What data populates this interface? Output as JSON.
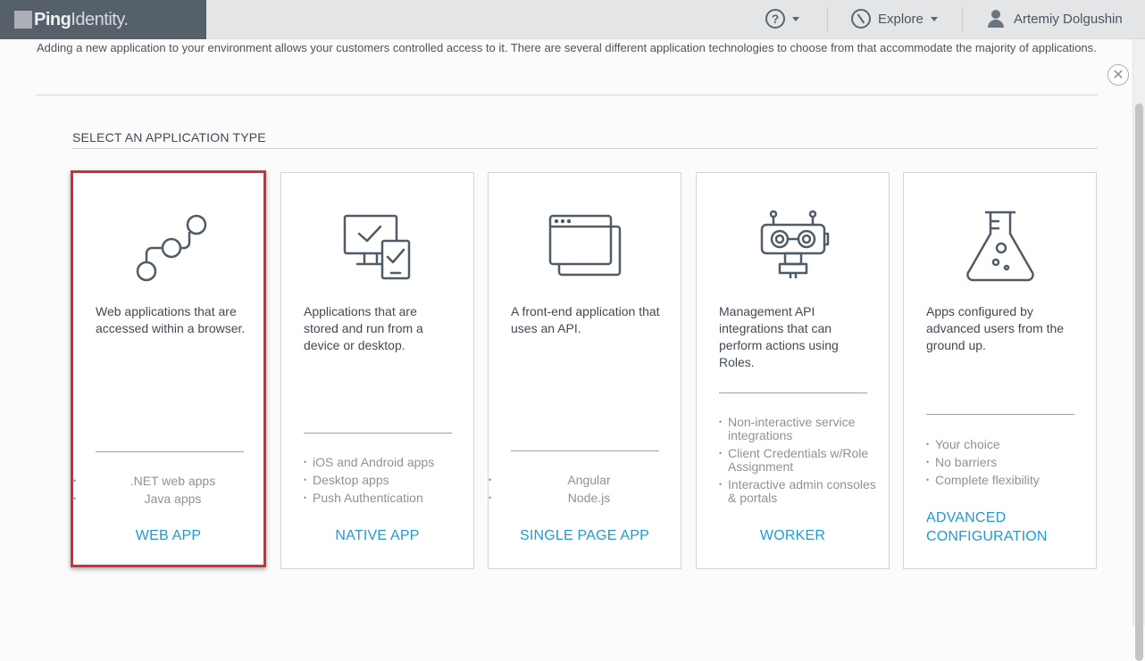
{
  "header": {
    "brand_bold": "Ping",
    "brand_light": "Identity.",
    "explore_label": "Explore",
    "user_name": "Artemiy Dolgushin"
  },
  "intro": {
    "text": "Adding a new application to your environment allows your customers controlled access to it. There are several different application technologies to choose from that accommodate the majority of applications."
  },
  "close_symbol": "✕",
  "section_title": "SELECT AN APPLICATION TYPE",
  "cards": [
    {
      "description": "Web applications that are accessed within a browser.",
      "items": [
        ".NET web apps",
        "Java apps"
      ],
      "link": "WEB APP",
      "icon": "workflow-nodes-icon"
    },
    {
      "description": "Applications that are stored and run from a device or desktop.",
      "items": [
        "iOS and Android apps",
        "Desktop apps",
        "Push Authentication"
      ],
      "link": "NATIVE APP",
      "icon": "monitor-device-check-icon"
    },
    {
      "description": "A front-end application that uses an API.",
      "items": [
        "Angular",
        "Node.js"
      ],
      "link": "SINGLE PAGE APP",
      "icon": "browser-windows-icon"
    },
    {
      "description": "Management API integrations that can perform actions using Roles.",
      "items": [
        "Non-interactive service integrations",
        "Client Credentials w/Role Assignment",
        "Interactive admin consoles & portals"
      ],
      "link": "WORKER",
      "icon": "robot-icon"
    },
    {
      "description": "Apps configured by advanced users from the ground up.",
      "items": [
        "Your choice",
        "No barriers",
        "Complete flexibility"
      ],
      "link": "ADVANCED CONFIGURATION",
      "icon": "flask-icon"
    }
  ],
  "colors": {
    "accent": "#1e9bd7",
    "selection": "#d32f2f",
    "brand_bg": "#56606b"
  }
}
